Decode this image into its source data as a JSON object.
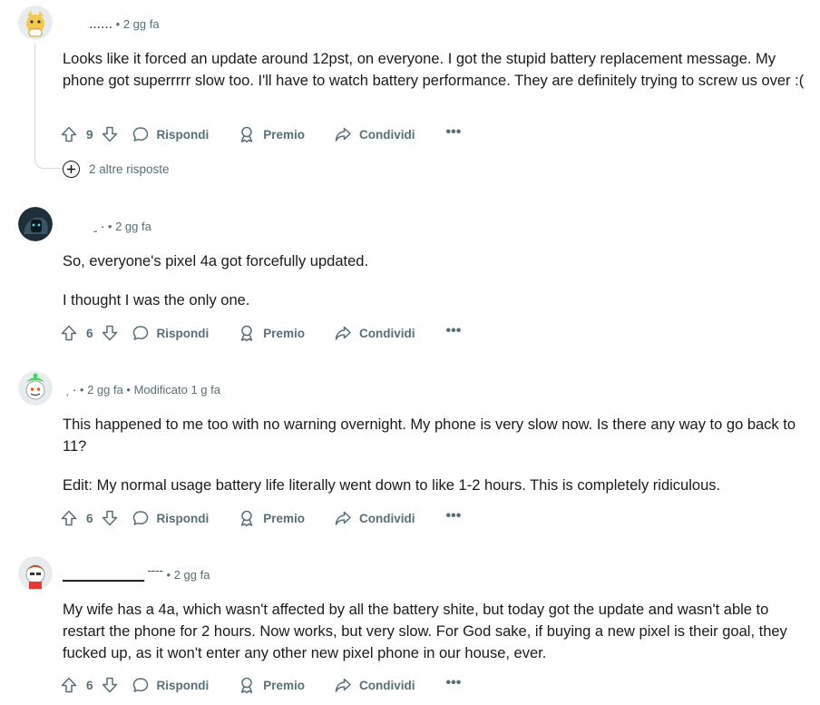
{
  "comments": [
    {
      "username": "‥‥‥",
      "meta": "• 2 gg fa",
      "paragraphs": [
        "Looks like it forced an update around 12pst, on everyone. I got the stupid battery replacement message. My phone got superrrrr slow too. I'll have to watch battery performance. They are definitely trying to screw us over :("
      ],
      "votes": "9",
      "more_replies": "2 altre risposte"
    },
    {
      "username": "ˍ ·",
      "meta": "• 2 gg fa",
      "paragraphs": [
        "So, everyone's pixel 4a got forcefully updated.",
        "I thought I was the only one."
      ],
      "votes": "6"
    },
    {
      "username": "ˌ                    ·",
      "meta": "• 2 gg fa • Modificato 1 g fa",
      "paragraphs": [
        "This happened to me too with no warning overnight. My phone is very slow now. Is there any way to go back to 11?",
        "Edit: My normal usage battery life literally went down to like 1-2 hours. This is completely ridiculous."
      ],
      "votes": "6"
    },
    {
      "username": "▁▁▁▁▁▁▁▁▁  ˉˉˉˉ",
      "meta": "• 2 gg fa",
      "paragraphs": [
        "My wife has a 4a, which wasn't affected by all the battery shite, but today got the update and wasn't able to restart the phone for 2 hours. Now works, but very slow. For God sake, if buying a new pixel is their goal, they fucked up, as it won't enter any other new pixel phone in our house, ever."
      ],
      "votes": "6"
    }
  ],
  "actions": {
    "reply_label": "Rispondi",
    "award_label": "Premio",
    "share_label": "Condividi",
    "more_label": "•••"
  },
  "icons": [
    "upvote-icon",
    "downvote-icon",
    "reply-icon",
    "award-icon",
    "share-icon",
    "more-icon",
    "plus-icon"
  ],
  "colors": {
    "text": "#1a1a1b",
    "muted": "#576f76",
    "thread": "#d6dadc"
  }
}
